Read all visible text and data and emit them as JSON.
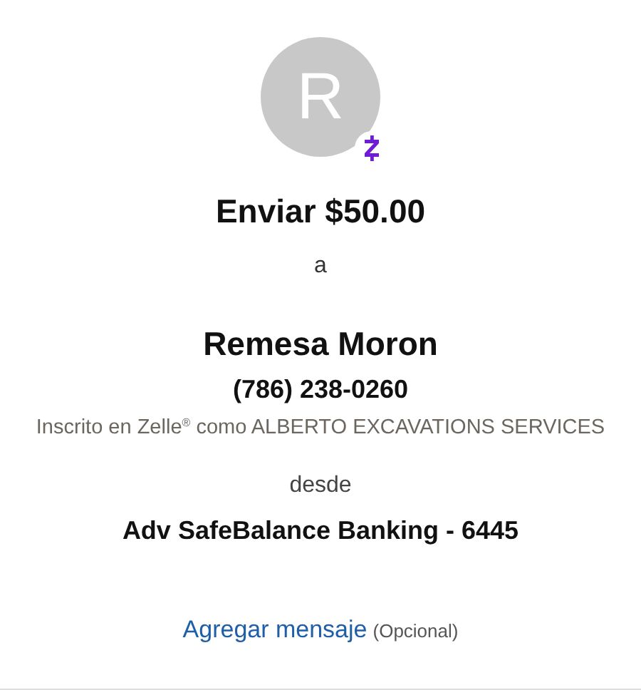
{
  "avatar": {
    "initial": "R"
  },
  "amount_title": "Enviar $50.00",
  "connector_to": "a",
  "recipient": {
    "name": "Remesa Moron",
    "phone": "(786) 238-0260",
    "enrolled_note": "Inscrito en Zelle$^{®}$ como ALBERTO EXCAVATIONS SERVICES"
  },
  "connector_from": "desde",
  "account": "Adv SafeBalance Banking - 6445",
  "message": {
    "link": "Agregar mensaje",
    "hint": "(Opcional)"
  }
}
